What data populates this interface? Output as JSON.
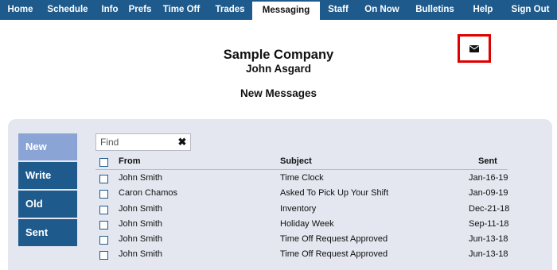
{
  "nav": {
    "items": [
      {
        "label": "Home"
      },
      {
        "label": "Schedule"
      },
      {
        "label": "Info"
      },
      {
        "label": "Prefs"
      },
      {
        "label": "Time Off"
      },
      {
        "label": "Trades"
      },
      {
        "label": "Messaging"
      },
      {
        "label": "Staff"
      },
      {
        "label": "On Now"
      },
      {
        "label": "Bulletins"
      },
      {
        "label": "Help"
      },
      {
        "label": "Sign Out"
      }
    ],
    "active": "Messaging"
  },
  "header": {
    "company": "Sample Company",
    "user": "John Asgard",
    "section_title": "New Messages"
  },
  "envelope_icon": "envelope-icon",
  "sidebar": {
    "items": [
      {
        "label": "New"
      },
      {
        "label": "Write"
      },
      {
        "label": "Old"
      },
      {
        "label": "Sent"
      }
    ],
    "active": "New"
  },
  "search": {
    "placeholder": "Find",
    "value": "",
    "clear_label": "✖"
  },
  "table": {
    "columns": {
      "from": "From",
      "subject": "Subject",
      "sent": "Sent"
    },
    "rows": [
      {
        "from": "John Smith",
        "subject": "Time Clock",
        "sent": "Jan-16-19"
      },
      {
        "from": "Caron Chamos",
        "subject": "Asked To Pick Up Your Shift",
        "sent": "Jan-09-19"
      },
      {
        "from": "John Smith",
        "subject": "Inventory",
        "sent": "Dec-21-18"
      },
      {
        "from": "John Smith",
        "subject": "Holiday Week",
        "sent": "Sep-11-18"
      },
      {
        "from": "John Smith",
        "subject": "Time Off Request Approved",
        "sent": "Jun-13-18"
      },
      {
        "from": "John Smith",
        "subject": "Time Off Request Approved",
        "sent": "Jun-13-18"
      }
    ]
  },
  "colors": {
    "nav_bg": "#1e5a8c",
    "active_side": "#8aa4d6",
    "panel_bg": "#e4e6f0",
    "highlight_border": "#e00000"
  }
}
